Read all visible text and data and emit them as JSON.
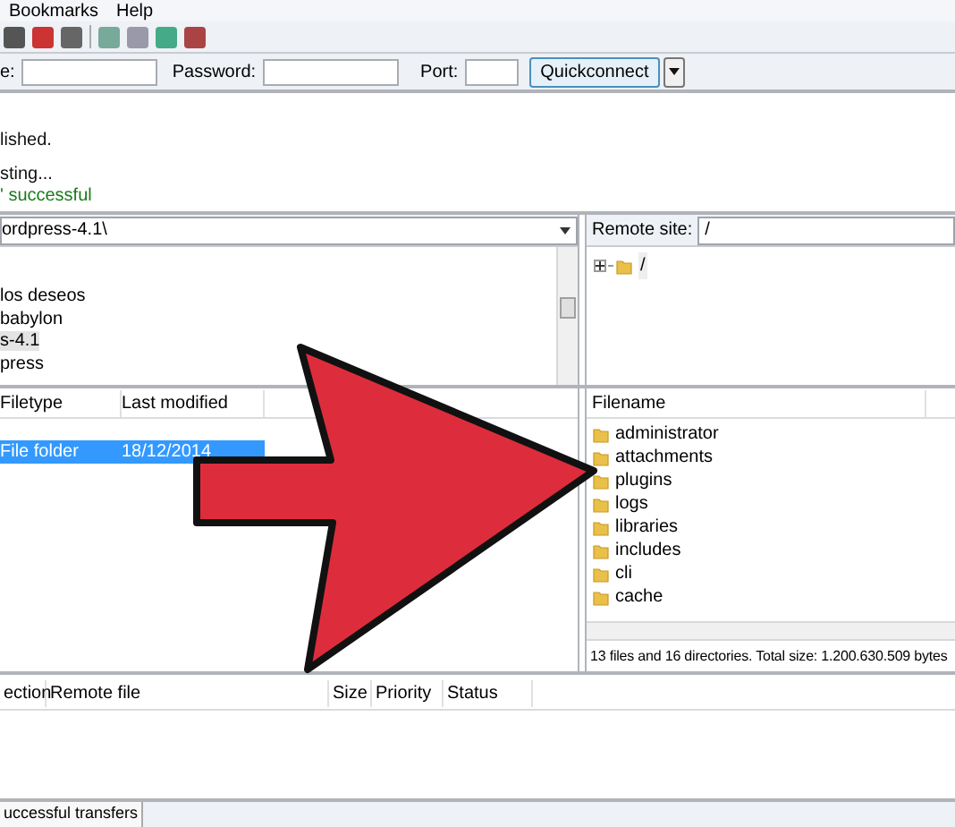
{
  "menu": [
    "Bookmarks",
    "Help"
  ],
  "quickconnect": {
    "fields": [
      {
        "label": "e:"
      },
      {
        "label": "Password:"
      },
      {
        "label": "Port:"
      }
    ],
    "button": "Quickconnect"
  },
  "log": [
    {
      "text": "lished.",
      "kind": "status"
    },
    {
      "text": "sting...",
      "kind": "status"
    },
    {
      "text": "' successful",
      "kind": "response"
    }
  ],
  "local": {
    "path": "ordpress-4.1\\",
    "tree": [
      {
        "label": "los deseos",
        "selected": false
      },
      {
        "label": "babylon",
        "selected": false
      },
      {
        "label": "s-4.1",
        "selected": true
      },
      {
        "label": "press",
        "selected": false
      }
    ],
    "columns": [
      "Filetype",
      "Last modified"
    ],
    "rows": [
      {
        "filetype": "File folder",
        "last_modified": "18/12/2014",
        "selected": true
      }
    ]
  },
  "remote": {
    "label": "Remote site:",
    "path": "/",
    "tree": [
      {
        "label": "/",
        "expanded": false
      }
    ],
    "columns": [
      "Filename"
    ],
    "files": [
      "administrator",
      "attachments",
      "plugins",
      "logs",
      "libraries",
      "includes",
      "cli",
      "cache"
    ],
    "status": "13 files and 16 directories. Total size: 1.200.630.509 bytes"
  },
  "queue": {
    "columns": [
      "ection",
      "Remote file",
      "Size",
      "Priority",
      "Status"
    ]
  },
  "tabs": [
    {
      "label": "uccessful transfers",
      "selected": true
    }
  ]
}
